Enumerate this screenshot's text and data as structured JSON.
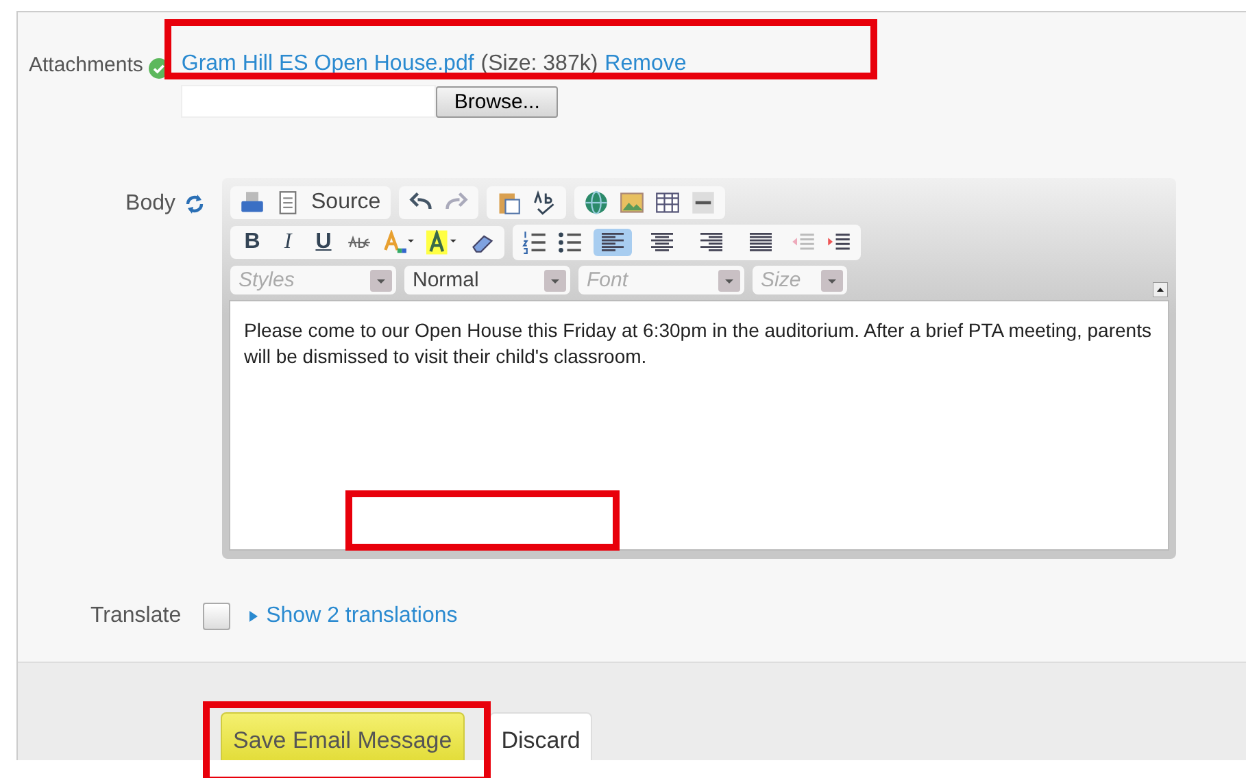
{
  "attachments": {
    "label": "Attachments",
    "file": "Gram Hill ES Open House.pdf",
    "size": "(Size: 387k)",
    "remove": "Remove",
    "browse": "Browse..."
  },
  "body": {
    "label": "Body",
    "source": "Source",
    "format": [
      "B",
      "I",
      "U"
    ],
    "alignment": [
      {
        "selected": true
      },
      {
        "selected": false
      },
      {
        "selected": false
      },
      {
        "selected": false
      }
    ],
    "combos": [
      {
        "placeholder": "Styles"
      },
      {
        "value": "Normal"
      },
      {
        "placeholder": "Font"
      },
      {
        "placeholder": "Size"
      }
    ],
    "text": "Please come to our Open House this Friday at 6:30pm in the auditorium.  After a brief PTA meeting, parents will be dismissed to visit their child's classroom."
  },
  "translate": {
    "label": "Translate",
    "checked": false,
    "link": "Show 2 translations"
  },
  "buttons": [
    {
      "label": "Save Email Message",
      "kind": "primary"
    },
    {
      "label": "Discard",
      "kind": "secondary"
    }
  ],
  "highlights": [
    {
      "kind": "attachment"
    },
    {
      "kind": "body"
    },
    {
      "kind": "save"
    }
  ]
}
